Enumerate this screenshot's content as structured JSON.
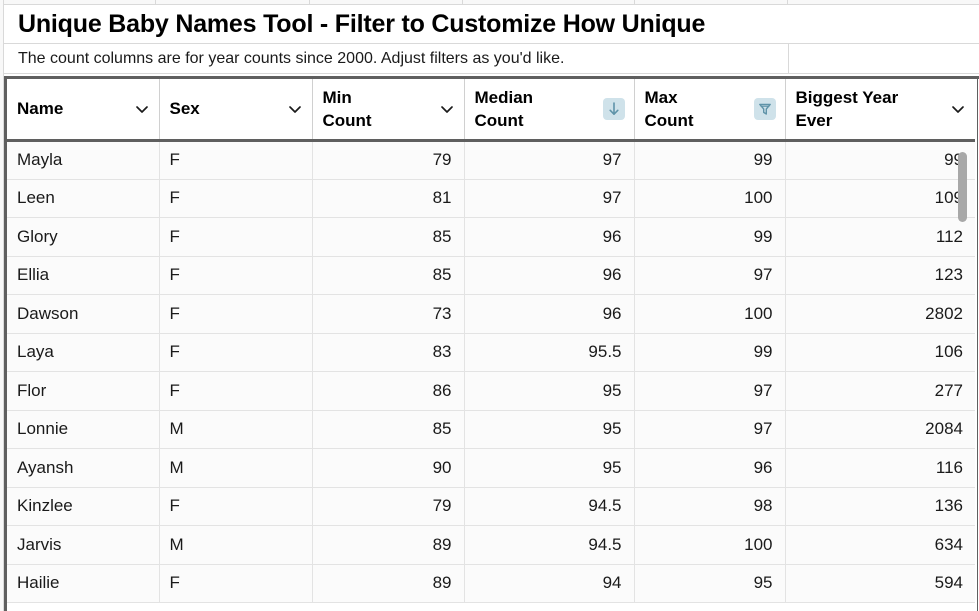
{
  "header": {
    "title": "Unique Baby Names Tool - Filter to Customize How Unique",
    "subtitle": "The count columns are for year counts since 2000. Adjust filters as you'd like."
  },
  "table": {
    "columns": [
      {
        "label_line1": "Name",
        "label_line2": "",
        "icon": "chevron-down-icon",
        "align": "left"
      },
      {
        "label_line1": "Sex",
        "label_line2": "",
        "icon": "chevron-down-icon",
        "align": "left"
      },
      {
        "label_line1": "Min",
        "label_line2": "Count",
        "icon": "chevron-down-icon",
        "align": "left"
      },
      {
        "label_line1": "Median",
        "label_line2": "Count",
        "icon": "sort-descending-icon",
        "align": "left"
      },
      {
        "label_line1": "Max",
        "label_line2": "Count",
        "icon": "filter-funnel-icon",
        "align": "left"
      },
      {
        "label_line1": "Biggest Year",
        "label_line2": "Ever",
        "icon": "chevron-down-icon",
        "align": "left"
      }
    ],
    "rows": [
      {
        "name": "Mayla",
        "sex": "F",
        "min_count": "79",
        "median_count": "97",
        "max_count": "99",
        "biggest_year_ever": "99"
      },
      {
        "name": "Leen",
        "sex": "F",
        "min_count": "81",
        "median_count": "97",
        "max_count": "100",
        "biggest_year_ever": "109"
      },
      {
        "name": "Glory",
        "sex": "F",
        "min_count": "85",
        "median_count": "96",
        "max_count": "99",
        "biggest_year_ever": "112"
      },
      {
        "name": "Ellia",
        "sex": "F",
        "min_count": "85",
        "median_count": "96",
        "max_count": "97",
        "biggest_year_ever": "123"
      },
      {
        "name": "Dawson",
        "sex": "F",
        "min_count": "73",
        "median_count": "96",
        "max_count": "100",
        "biggest_year_ever": "2802"
      },
      {
        "name": "Laya",
        "sex": "F",
        "min_count": "83",
        "median_count": "95.5",
        "max_count": "99",
        "biggest_year_ever": "106"
      },
      {
        "name": "Flor",
        "sex": "F",
        "min_count": "86",
        "median_count": "95",
        "max_count": "97",
        "biggest_year_ever": "277"
      },
      {
        "name": "Lonnie",
        "sex": "M",
        "min_count": "85",
        "median_count": "95",
        "max_count": "97",
        "biggest_year_ever": "2084"
      },
      {
        "name": "Ayansh",
        "sex": "M",
        "min_count": "90",
        "median_count": "95",
        "max_count": "96",
        "biggest_year_ever": "116"
      },
      {
        "name": "Kinzlee",
        "sex": "F",
        "min_count": "79",
        "median_count": "94.5",
        "max_count": "98",
        "biggest_year_ever": "136"
      },
      {
        "name": "Jarvis",
        "sex": "M",
        "min_count": "89",
        "median_count": "94.5",
        "max_count": "100",
        "biggest_year_ever": "634"
      },
      {
        "name": "Hailie",
        "sex": "F",
        "min_count": "89",
        "median_count": "94",
        "max_count": "95",
        "biggest_year_ever": "594"
      }
    ]
  },
  "colors": {
    "icon_badge_background": "#cfe2ea",
    "icon_blue": "#5e93a8",
    "chevron": "#1a1a1a",
    "table_border_dark": "#5f5f5f",
    "row_background": "#fbfbfb",
    "scrollbar_thumb": "#a8a8a8"
  }
}
